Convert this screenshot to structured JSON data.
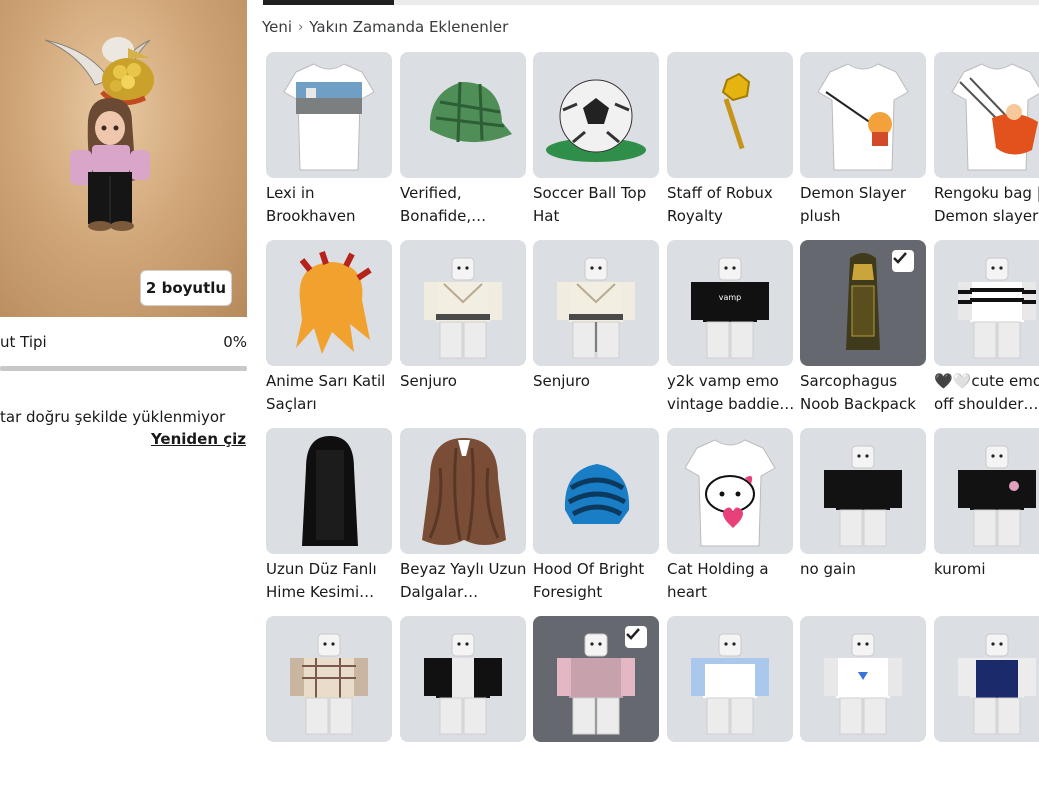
{
  "avatar_panel": {
    "toggle_label": "2 boyutlu",
    "body_type_label": "ut Tipi",
    "body_type_value": "0%",
    "warning": "tar doğru şekilde yüklenmiyor",
    "redraw_label": "Yeniden çiz"
  },
  "breadcrumb": {
    "root": "Yeni",
    "current": "Yakın Zamanda Eklenenler"
  },
  "items": [
    {
      "name": "Lexi in\nBrookhaven"
    },
    {
      "name": "Verified,\nBonafide,…"
    },
    {
      "name": "Soccer Ball Top\nHat"
    },
    {
      "name": "Staff of Robux\nRoyalty"
    },
    {
      "name": "Demon Slayer\nplush"
    },
    {
      "name": "Rengoku bag |\nDemon slayer"
    },
    {
      "name": "Anime Sarı Katil\nSaçları"
    },
    {
      "name": "Senjuro"
    },
    {
      "name": "Senjuro"
    },
    {
      "name": "y2k vamp emo\nvintage baddie…"
    },
    {
      "name": "Sarcophagus\nNoob Backpack",
      "selected": true
    },
    {
      "name": "🖤🤍cute emo\noff shoulder…"
    },
    {
      "name": "Uzun Düz Fanlı\nHime Kesimi…"
    },
    {
      "name": "Beyaz Yaylı Uzun\nDalgalar…"
    },
    {
      "name": "Hood Of Bright\nForesight"
    },
    {
      "name": "Cat Holding a\nheart"
    },
    {
      "name": "no gain"
    },
    {
      "name": "kuromi"
    },
    {
      "name": ""
    },
    {
      "name": ""
    },
    {
      "name": "",
      "selected": true
    },
    {
      "name": ""
    },
    {
      "name": ""
    },
    {
      "name": ""
    }
  ]
}
